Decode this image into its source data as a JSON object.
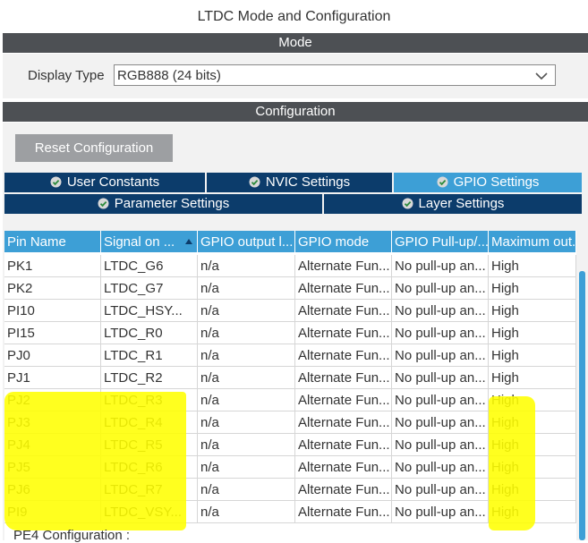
{
  "window": {
    "title": "LTDC Mode and Configuration"
  },
  "mode": {
    "header": "Mode",
    "display_type_label": "Display Type",
    "display_type_value": "RGB888 (24 bits)"
  },
  "configuration": {
    "header": "Configuration",
    "reset_label": "Reset Configuration",
    "tabs_row1": [
      {
        "label": "User Constants",
        "active": false
      },
      {
        "label": "NVIC Settings",
        "active": false
      },
      {
        "label": "GPIO Settings",
        "active": true
      }
    ],
    "tabs_row2": [
      {
        "label": "Parameter Settings",
        "active": false
      },
      {
        "label": "Layer Settings",
        "active": false
      }
    ]
  },
  "table": {
    "columns": [
      "Pin Name",
      "Signal on ...",
      "GPIO output l...",
      "GPIO mode",
      "GPIO Pull-up/...",
      "Maximum out..."
    ],
    "rows": [
      [
        "PK1",
        "LTDC_G6",
        "n/a",
        "Alternate Fun...",
        "No pull-up an...",
        "High"
      ],
      [
        "PK2",
        "LTDC_G7",
        "n/a",
        "Alternate Fun...",
        "No pull-up an...",
        "High"
      ],
      [
        "PI10",
        "LTDC_HSY...",
        "n/a",
        "Alternate Fun...",
        "No pull-up an...",
        "High"
      ],
      [
        "PI15",
        "LTDC_R0",
        "n/a",
        "Alternate Fun...",
        "No pull-up an...",
        "High"
      ],
      [
        "PJ0",
        "LTDC_R1",
        "n/a",
        "Alternate Fun...",
        "No pull-up an...",
        "High"
      ],
      [
        "PJ1",
        "LTDC_R2",
        "n/a",
        "Alternate Fun...",
        "No pull-up an...",
        "High"
      ],
      [
        "PJ2",
        "LTDC_R3",
        "n/a",
        "Alternate Fun...",
        "No pull-up an...",
        "High"
      ],
      [
        "PJ3",
        "LTDC_R4",
        "n/a",
        "Alternate Fun...",
        "No pull-up an...",
        "High"
      ],
      [
        "PJ4",
        "LTDC_R5",
        "n/a",
        "Alternate Fun...",
        "No pull-up an...",
        "High"
      ],
      [
        "PJ5",
        "LTDC_R6",
        "n/a",
        "Alternate Fun...",
        "No pull-up an...",
        "High"
      ],
      [
        "PJ6",
        "LTDC_R7",
        "n/a",
        "Alternate Fun...",
        "No pull-up an...",
        "High"
      ],
      [
        "PI9",
        "LTDC_VSY...",
        "n/a",
        "Alternate Fun...",
        "No pull-up an...",
        "High"
      ]
    ]
  },
  "below_label": "PE4 Configuration :",
  "colors": {
    "accent": "#3d9fd6",
    "tab_dark": "#0c3c6b",
    "section_bar": "#4d5054",
    "highlight": "#ffff00"
  },
  "icons": {
    "tab_status": "check-circle-icon",
    "sort": "sort-ascending-icon",
    "dropdown": "chevron-down-icon"
  }
}
